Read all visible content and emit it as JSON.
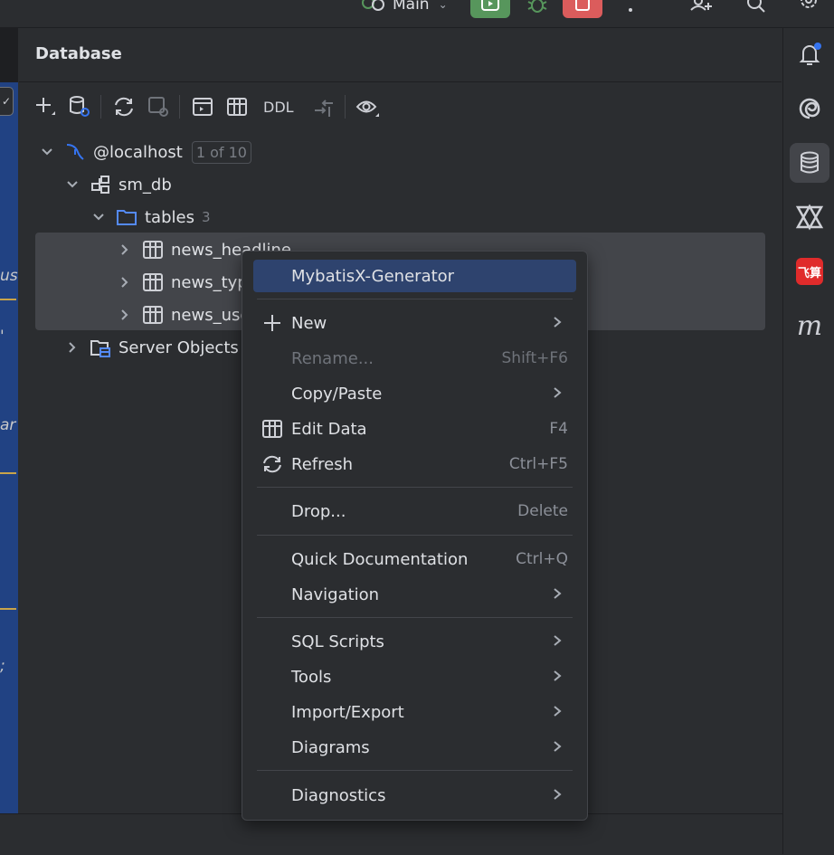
{
  "topbar": {
    "run_config": "Main"
  },
  "panel": {
    "title": "Database",
    "toolbar": {
      "ddl_label": "DDL"
    }
  },
  "tree": {
    "host": {
      "label": "@localhost",
      "badge": "1 of 10"
    },
    "schema": {
      "label": "sm_db"
    },
    "tables": {
      "label": "tables",
      "count": "3"
    },
    "table_items": [
      {
        "label": "news_headline"
      },
      {
        "label": "news_type"
      },
      {
        "label": "news_user"
      }
    ],
    "server_objects": {
      "label": "Server Objects"
    }
  },
  "context_menu": {
    "items": [
      {
        "label": "MybatisX-Generator"
      },
      {
        "label": "New"
      },
      {
        "label": "Rename...",
        "shortcut": "Shift+F6"
      },
      {
        "label": "Copy/Paste"
      },
      {
        "label": "Edit Data",
        "shortcut": "F4"
      },
      {
        "label": "Refresh",
        "shortcut": "Ctrl+F5"
      },
      {
        "label": "Drop...",
        "shortcut": "Delete"
      },
      {
        "label": "Quick Documentation",
        "shortcut": "Ctrl+Q"
      },
      {
        "label": "Navigation"
      },
      {
        "label": "SQL Scripts"
      },
      {
        "label": "Tools"
      },
      {
        "label": "Import/Export"
      },
      {
        "label": "Diagrams"
      },
      {
        "label": "Diagnostics"
      }
    ]
  },
  "right_strip": {
    "feishu_label": "飞算"
  },
  "editor_fragments": [
    "us",
    "'",
    "ar",
    ";"
  ],
  "colors": {
    "accent": "#3574f0",
    "selection": "#2e436e",
    "run": "#57965c",
    "stop": "#db5c5c"
  }
}
